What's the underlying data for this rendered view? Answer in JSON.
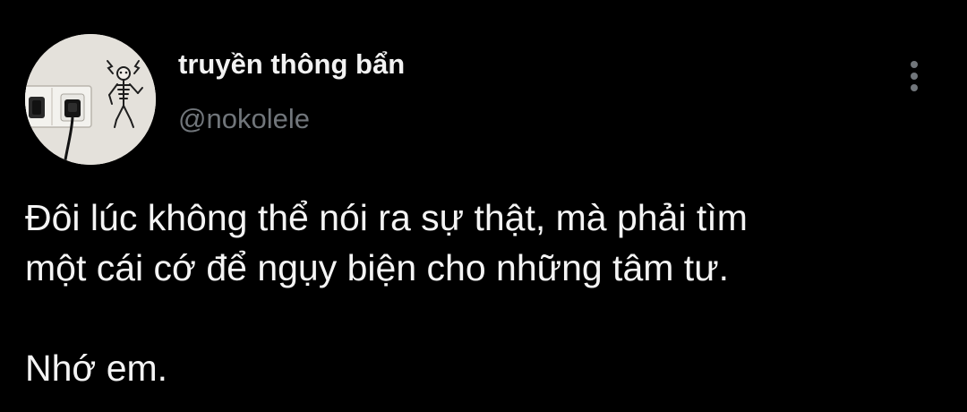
{
  "colors": {
    "background": "#000000",
    "display_name": "#f2f2f2",
    "handle": "#71767b",
    "text": "#f4f4f4",
    "menu_dots": "#71767b"
  },
  "author": {
    "display_name": "truyền thông bẩn",
    "handle": "@nokolele",
    "avatar_icon": "avatar-image"
  },
  "more_menu": {
    "icon": "vertical-ellipsis-icon"
  },
  "tweet": {
    "line_1": "Đôi lúc không thể nói ra sự thật, mà phải tìm",
    "line_2": "một cái cớ để ngụy biện cho những tâm tư.",
    "line_3": "Nhớ em."
  }
}
